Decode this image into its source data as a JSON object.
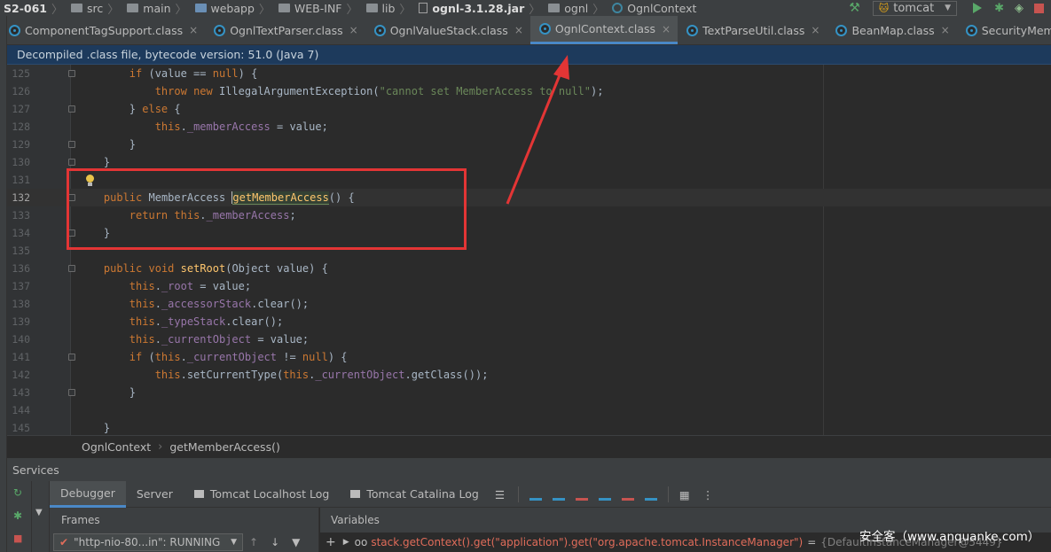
{
  "navbar": {
    "crumbs": [
      {
        "label": "S2-061",
        "bold": true,
        "icon": "none"
      },
      {
        "label": "src",
        "icon": "folder-icon"
      },
      {
        "label": "main",
        "icon": "folder-icon"
      },
      {
        "label": "webapp",
        "icon": "web-folder-icon"
      },
      {
        "label": "WEB-INF",
        "icon": "folder-icon"
      },
      {
        "label": "lib",
        "icon": "folder-icon"
      },
      {
        "label": "ognl-3.1.28.jar",
        "bold": true,
        "icon": "jar-icon"
      },
      {
        "label": "ognl",
        "icon": "package-icon"
      },
      {
        "label": "OgnlContext",
        "icon": "class-icon"
      }
    ],
    "run_config": "tomcat"
  },
  "tabs": [
    {
      "label": "ComponentTagSupport.class",
      "active": false
    },
    {
      "label": "OgnlTextParser.class",
      "active": false
    },
    {
      "label": "OgnlValueStack.class",
      "active": false
    },
    {
      "label": "OgnlContext.class",
      "active": true
    },
    {
      "label": "TextParseUtil.class",
      "active": false
    },
    {
      "label": "BeanMap.class",
      "active": false
    },
    {
      "label": "SecurityMemberAccess.class",
      "active": false
    }
  ],
  "tab_close_glyph": "×",
  "banner": "Decompiled .class file, bytecode version: 51.0 (Java 7)",
  "editor": {
    "current_line": "132",
    "lines": [
      {
        "num": "125",
        "code": "        if (value == null) {"
      },
      {
        "num": "126",
        "code": "            throw new IllegalArgumentException(\"cannot set MemberAccess to null\");"
      },
      {
        "num": "127",
        "code": "        } else {"
      },
      {
        "num": "128",
        "code": "            this._memberAccess = value;"
      },
      {
        "num": "129",
        "code": "        }"
      },
      {
        "num": "130",
        "code": "    }"
      },
      {
        "num": "131",
        "code": ""
      },
      {
        "num": "132",
        "code": "    public MemberAccess getMemberAccess() {"
      },
      {
        "num": "133",
        "code": "        return this._memberAccess;"
      },
      {
        "num": "134",
        "code": "    }"
      },
      {
        "num": "135",
        "code": ""
      },
      {
        "num": "136",
        "code": "    public void setRoot(Object value) {"
      },
      {
        "num": "137",
        "code": "        this._root = value;"
      },
      {
        "num": "138",
        "code": "        this._accessorStack.clear();"
      },
      {
        "num": "139",
        "code": "        this._typeStack.clear();"
      },
      {
        "num": "140",
        "code": "        this._currentObject = value;"
      },
      {
        "num": "141",
        "code": "        if (this._currentObject != null) {"
      },
      {
        "num": "142",
        "code": "            this.setCurrentType(this._currentObject.getClass());"
      },
      {
        "num": "143",
        "code": "        }"
      },
      {
        "num": "144",
        "code": ""
      },
      {
        "num": "145",
        "code": "    }"
      }
    ]
  },
  "editor_breadcrumb": [
    "OgnlContext",
    "getMemberAccess()"
  ],
  "services": {
    "title": "Services",
    "debug_tabs": [
      {
        "label": "Debugger",
        "active": true,
        "icon": "none"
      },
      {
        "label": "Server",
        "active": false,
        "icon": "none"
      },
      {
        "label": "Tomcat Localhost Log",
        "active": false,
        "icon": "log-icon"
      },
      {
        "label": "Tomcat Catalina Log",
        "active": false,
        "icon": "log-icon"
      }
    ],
    "frames_label": "Frames",
    "variables_label": "Variables",
    "thread": "\"http-nio-80...in\": RUNNING",
    "variable_expr": "stack.getContext().get(\"application\").get(\"org.apache.tomcat.InstanceManager\")",
    "variable_value": "{DefaultInstanceManager@5449}"
  },
  "watermark": "安全客（www.anquanke.com）",
  "colors": {
    "annotation_red": "#e33535",
    "accent_blue": "#4a88c7",
    "banner_bg": "#1d3a5c"
  }
}
